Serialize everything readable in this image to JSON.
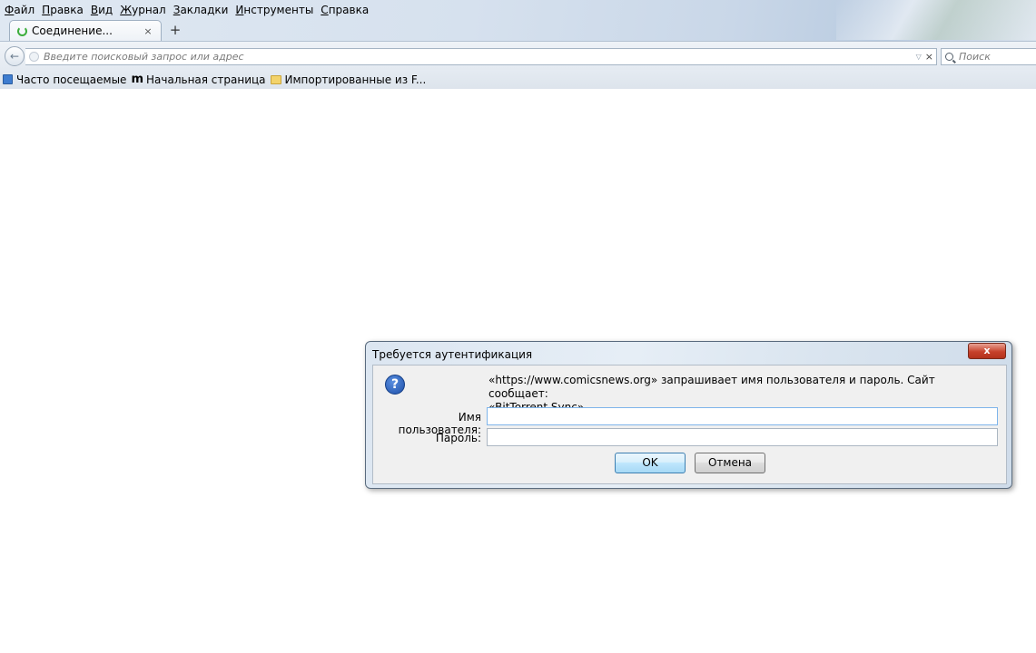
{
  "menubar": {
    "items": [
      {
        "key": "Ф",
        "rest": "айл"
      },
      {
        "key": "П",
        "rest": "равка"
      },
      {
        "key": "В",
        "rest": "ид"
      },
      {
        "key": "Ж",
        "rest": "урнал"
      },
      {
        "key": "З",
        "rest": "акладки"
      },
      {
        "key": "И",
        "rest": "нструменты"
      },
      {
        "key": "С",
        "rest": "правка"
      }
    ]
  },
  "tab": {
    "title": "Соединение...",
    "close": "×",
    "new_tab": "+"
  },
  "navbar": {
    "back": "←",
    "url_placeholder": "Введите поисковый запрос или адрес",
    "url_dropdown": "▽",
    "url_clear": "×",
    "search_placeholder": "Поиск"
  },
  "bookmarks": {
    "frequent": "Часто посещаемые",
    "m_logo": "m",
    "home": "Начальная страница",
    "imported": "Импортированные из F..."
  },
  "dialog": {
    "title": "Требуется аутентификация",
    "close": "x",
    "question_mark": "?",
    "message_line1": "«https://www.comicsnews.org» запрашивает имя пользователя и пароль. Сайт сообщает:",
    "message_line2": "«BitTorrent Sync»",
    "username_label": "Имя пользователя:",
    "username_value": "",
    "password_label": "Пароль:",
    "password_value": "",
    "ok_label": "OK",
    "cancel_label": "Отмена"
  }
}
